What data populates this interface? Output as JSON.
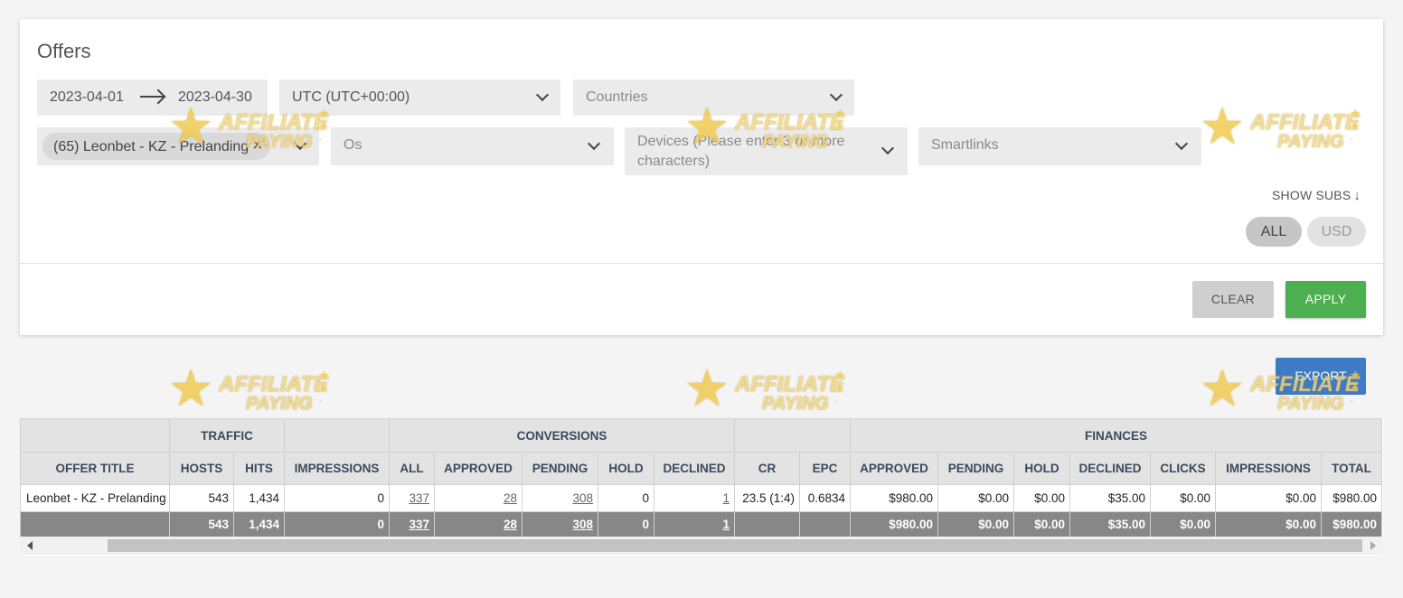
{
  "filters": {
    "title": "Offers",
    "date_from": "2023-04-01",
    "date_to": "2023-04-30",
    "timezone": "UTC (UTC+00:00)",
    "countries_placeholder": "Countries",
    "offer_chip": "(65) Leonbet - KZ - Prelanding",
    "os_placeholder": "Os",
    "devices_placeholder": "Devices (Please enter 3 or more characters)",
    "smartlinks_placeholder": "Smartlinks",
    "show_subs": "SHOW SUBS",
    "currency_all": "ALL",
    "currency_usd": "USD",
    "clear": "CLEAR",
    "apply": "APPLY"
  },
  "export": "EXPORT",
  "table": {
    "groups": {
      "traffic": "TRAFFIC",
      "conversions": "CONVERSIONS",
      "finances": "FINANCES"
    },
    "columns": [
      "OFFER TITLE",
      "HOSTS",
      "HITS",
      "IMPRESSIONS",
      "ALL",
      "APPROVED",
      "PENDING",
      "HOLD",
      "DECLINED",
      "CR",
      "EPC",
      "APPROVED",
      "PENDING",
      "HOLD",
      "DECLINED",
      "CLICKS",
      "IMPRESSIONS",
      "TOTAL"
    ],
    "row": [
      "Leonbet - KZ - Prelanding",
      "543",
      "1,434",
      "0",
      "337",
      "28",
      "308",
      "0",
      "1",
      "23.5 (1:4)",
      "0.6834",
      "$980.00",
      "$0.00",
      "$0.00",
      "$35.00",
      "$0.00",
      "$0.00",
      "$980.00"
    ],
    "totals": [
      "",
      "543",
      "1,434",
      "0",
      "337",
      "28",
      "308",
      "0",
      "1",
      "",
      "",
      "$980.00",
      "$0.00",
      "$0.00",
      "$35.00",
      "$0.00",
      "$0.00",
      "$980.00"
    ]
  },
  "watermark": {
    "line1": "AFFILIATE",
    "line2": "PAYING"
  }
}
